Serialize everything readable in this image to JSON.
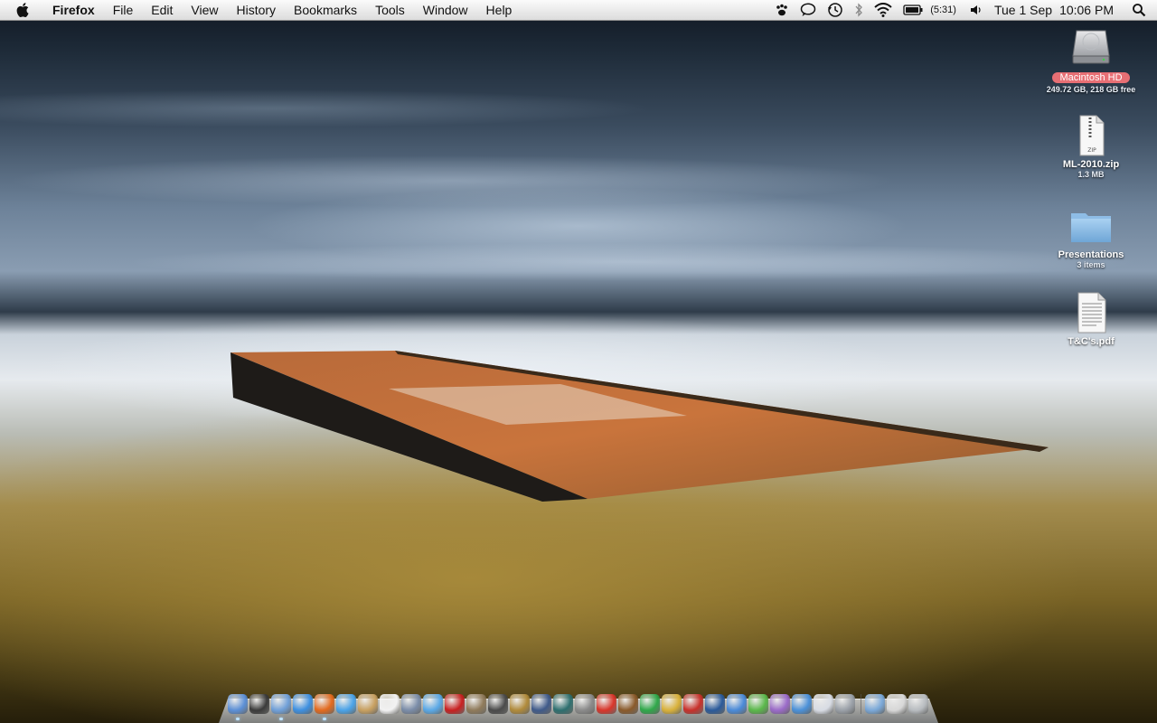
{
  "menubar": {
    "app_name": "Firefox",
    "menus": [
      "File",
      "Edit",
      "View",
      "History",
      "Bookmarks",
      "Tools",
      "Window",
      "Help"
    ],
    "battery_text": "(5:31)",
    "date": "Tue 1 Sep",
    "time": "10:06 PM"
  },
  "desktop_icons": [
    {
      "label": "Macintosh HD",
      "sub": "249.72 GB, 218 GB free",
      "icon": "hard-drive-icon"
    },
    {
      "label": "ML-2010.zip",
      "sub": "1.3 MB",
      "icon": "zip-file-icon"
    },
    {
      "label": "Presentations",
      "sub": "3 items",
      "icon": "folder-icon"
    },
    {
      "label": "T&C's.pdf",
      "sub": "",
      "icon": "pdf-file-icon"
    }
  ],
  "dock": {
    "apps": [
      {
        "icon": "finder-icon",
        "color": "#5b8fd6",
        "running": true
      },
      {
        "icon": "dashboard-icon",
        "color": "#3a3a3a",
        "running": false
      },
      {
        "icon": "mail-icon",
        "color": "#6f9fd8",
        "running": true
      },
      {
        "icon": "safari-icon",
        "color": "#3d8fe0",
        "running": false
      },
      {
        "icon": "firefox-icon",
        "color": "#e36a1e",
        "running": true
      },
      {
        "icon": "ichat-icon",
        "color": "#4aa3e8",
        "running": false
      },
      {
        "icon": "address-book-icon",
        "color": "#c8a060",
        "running": false
      },
      {
        "icon": "ical-icon",
        "color": "#f2f2f2",
        "running": false
      },
      {
        "icon": "preview-icon",
        "color": "#7a8ca8",
        "running": false
      },
      {
        "icon": "itunes-icon",
        "color": "#59a8e6",
        "running": false
      },
      {
        "icon": "photo-booth-icon",
        "color": "#c82020",
        "running": false
      },
      {
        "icon": "iphoto-icon",
        "color": "#8f7a5a",
        "running": false
      },
      {
        "icon": "imovie-icon",
        "color": "#4a4a4a",
        "running": false
      },
      {
        "icon": "garageband-icon",
        "color": "#b08a3a",
        "running": false
      },
      {
        "icon": "spaces-icon",
        "color": "#3f5a8a",
        "running": false
      },
      {
        "icon": "time-machine-icon",
        "color": "#2d6f6f",
        "running": false
      },
      {
        "icon": "utility-icon",
        "color": "#8a8a8a",
        "running": false
      },
      {
        "icon": "app-red-icon",
        "color": "#d8352a",
        "running": false
      },
      {
        "icon": "app-brown-icon",
        "color": "#8a5a2a",
        "running": false
      },
      {
        "icon": "app-green-icon",
        "color": "#2fa84a",
        "running": false
      },
      {
        "icon": "keychain-icon",
        "color": "#d9b13a",
        "running": false
      },
      {
        "icon": "app-red-house-icon",
        "color": "#c8302a",
        "running": false
      },
      {
        "icon": "google-earth-icon",
        "color": "#2a5a9a",
        "running": false
      },
      {
        "icon": "app-blue-icon",
        "color": "#4a8ad8",
        "running": false
      },
      {
        "icon": "app-green-leaf-icon",
        "color": "#5ab84a",
        "running": false
      },
      {
        "icon": "app-purple-icon",
        "color": "#9a6ac8",
        "running": false
      },
      {
        "icon": "people-icon",
        "color": "#4a90d8",
        "running": false
      },
      {
        "icon": "app-table-icon",
        "color": "#d8dce4",
        "running": false
      },
      {
        "icon": "app-gray-icon",
        "color": "#9aa0a8",
        "running": false
      }
    ],
    "stacks": [
      {
        "icon": "documents-folder-icon",
        "color": "#7aa8d8"
      },
      {
        "icon": "downloads-icon",
        "color": "#d8d8d8"
      },
      {
        "icon": "trash-icon",
        "color": "#b8bcc0"
      }
    ]
  }
}
